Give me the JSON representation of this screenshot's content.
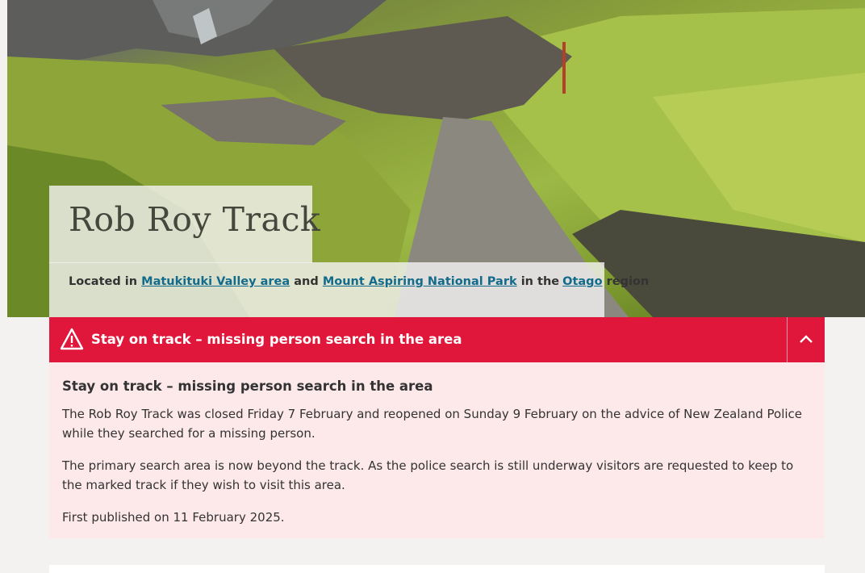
{
  "hero": {
    "title": "Rob Roy Track",
    "location": {
      "prefix": "Located in",
      "area_link": "Matukituki Valley area",
      "and": "and",
      "park_link": "Mount Aspiring National Park",
      "in_the": "in the",
      "region_link": "Otago",
      "suffix": "region"
    }
  },
  "alert": {
    "icon": "warning-triangle-icon",
    "title": "Stay on track – missing person search in the area",
    "toggle_icon": "chevron-up-icon",
    "color": "#e0173a",
    "body_color": "#fde8ea",
    "heading": "Stay on track – missing person search in the area",
    "paragraphs": [
      "The Rob Roy Track was closed Friday 7 February and reopened on Sunday 9 February on the advice of New Zealand Police while they searched for a missing person.",
      "The primary search area is now beyond the track. As the police search is still underway visitors are requested to keep to the marked track if they wish to visit this area.",
      "First published on 11 February 2025."
    ]
  },
  "colors": {
    "link": "#136b8b",
    "page_bg": "#f3f2f0"
  }
}
